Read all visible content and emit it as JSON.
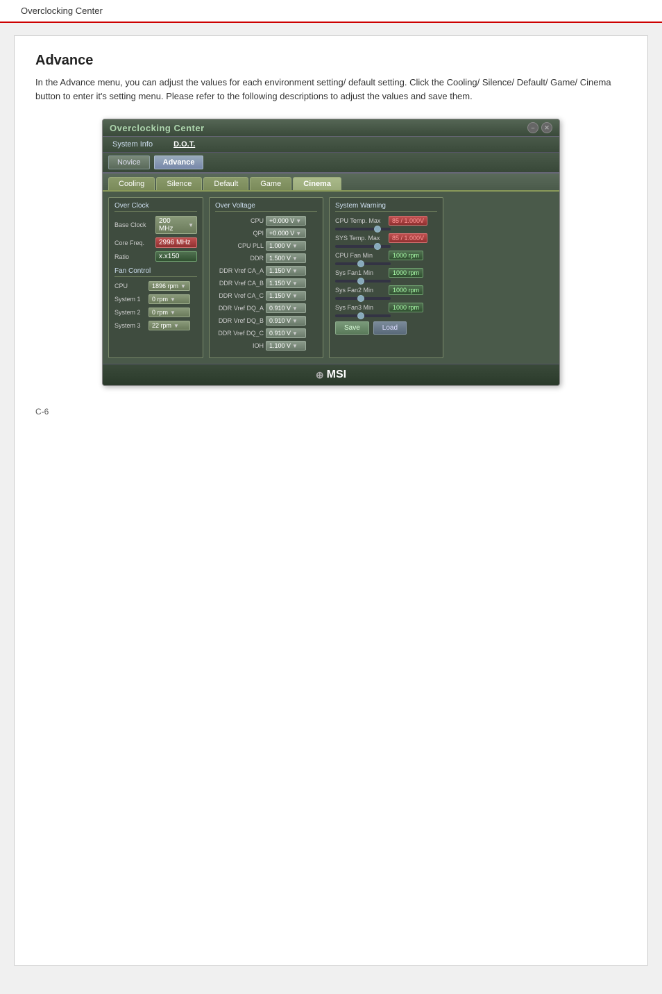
{
  "header": {
    "title": "Overclocking Center"
  },
  "page": {
    "section_title": "Advance",
    "description": "In the Advance menu, you can adjust the values for each environment setting/ default setting. Click the Cooling/ Silence/ Default/ Game/ Cinema button to enter it's setting menu. Please refer to the following descriptions to adjust the values and save them.",
    "page_number": "C-6"
  },
  "app": {
    "title": "Overclocking Center",
    "menu": [
      {
        "label": "System Info",
        "active": false
      },
      {
        "label": "D.O.T.",
        "active": false
      }
    ],
    "toolbar": [
      {
        "label": "Novice",
        "active": false
      },
      {
        "label": "Advance",
        "active": true
      }
    ],
    "tabs": [
      {
        "label": "Cooling",
        "active": false
      },
      {
        "label": "Silence",
        "active": false
      },
      {
        "label": "Default",
        "active": false
      },
      {
        "label": "Game",
        "active": false
      },
      {
        "label": "Cinema",
        "active": false
      }
    ],
    "over_clock": {
      "title": "Over Clock",
      "base_clock_label": "Base Clock",
      "base_clock_value": "200 MHz",
      "core_freq_label": "Core Freq.",
      "core_freq_value": "2996 MHz",
      "ratio_label": "Ratio",
      "ratio_value": "x.x150"
    },
    "over_voltage": {
      "title": "Over Voltage",
      "rows": [
        {
          "label": "CPU",
          "value": "+0.000 V"
        },
        {
          "label": "QPI",
          "value": "+0.000 V"
        },
        {
          "label": "CPU PLL",
          "value": "1.000 V"
        },
        {
          "label": "DDR",
          "value": "1.500 V"
        },
        {
          "label": "DDR Vref CA_A",
          "value": "1.150 V"
        },
        {
          "label": "DDR Vref CA_B",
          "value": "1.150 V"
        },
        {
          "label": "DDR Vref CA_C",
          "value": "1.150 V"
        },
        {
          "label": "DDR Vref DQ_A",
          "value": "0.910 V"
        },
        {
          "label": "DDR Vref DQ_B",
          "value": "0.910 V"
        },
        {
          "label": "DDR Vref DQ_C",
          "value": "0.910 V"
        },
        {
          "label": "IOH",
          "value": "1.100 V"
        }
      ]
    },
    "fan_control": {
      "title": "Fan Control",
      "rows": [
        {
          "label": "CPU",
          "value": "1896 rpm"
        },
        {
          "label": "System 1",
          "value": "0 rpm"
        },
        {
          "label": "System 2",
          "value": "0 rpm"
        },
        {
          "label": "System 3",
          "value": "22 rpm"
        }
      ]
    },
    "system_warning": {
      "title": "System Warning",
      "cpu_temp_max_label": "CPU Temp. Max",
      "cpu_temp_max_value": "85 / 1.000V",
      "sys_temp_max_label": "SYS Temp. Max",
      "sys_temp_max_value": "85 / 1.000V",
      "cpu_fan_min_label": "CPU Fan Min",
      "cpu_fan_min_value": "1000 rpm",
      "sys_fan1_min_label": "Sys Fan1 Min",
      "sys_fan1_min_value": "1000 rpm",
      "sys_fan2_min_label": "Sys Fan2 Min",
      "sys_fan2_min_value": "1000 rpm",
      "sys_fan3_min_label": "Sys Fan3 Min",
      "sys_fan3_min_value": "1000 rpm",
      "save_label": "Save",
      "load_label": "Load"
    },
    "footer": {
      "logo": "MSI",
      "logo_prefix": "⊕"
    }
  }
}
